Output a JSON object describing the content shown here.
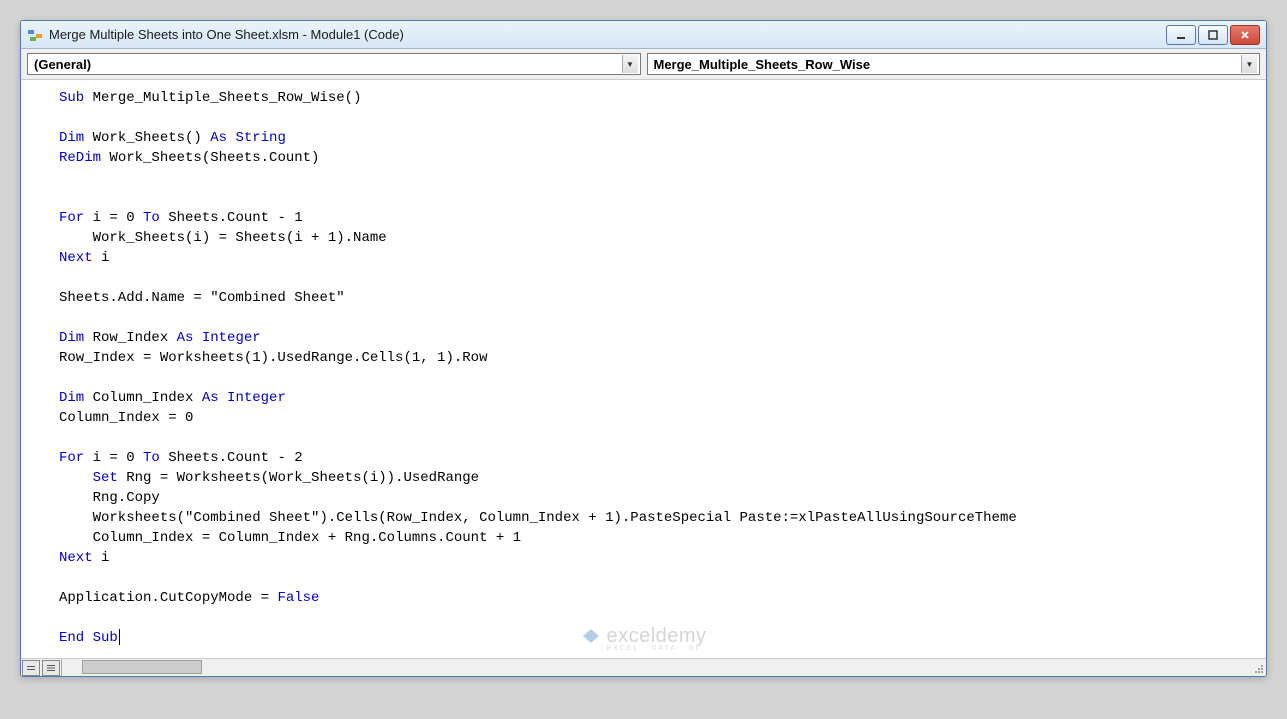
{
  "window": {
    "title": "Merge Multiple Sheets into One Sheet.xlsm - Module1 (Code)"
  },
  "dropdowns": {
    "left": "(General)",
    "right": "Merge_Multiple_Sheets_Row_Wise"
  },
  "code": {
    "tokens": [
      {
        "t": "kw",
        "v": "Sub"
      },
      {
        "t": "txt",
        "v": " Merge_Multiple_Sheets_Row_Wise()\n\n"
      },
      {
        "t": "kw",
        "v": "Dim"
      },
      {
        "t": "txt",
        "v": " Work_Sheets() "
      },
      {
        "t": "kw",
        "v": "As String"
      },
      {
        "t": "txt",
        "v": "\n"
      },
      {
        "t": "kw",
        "v": "ReDim"
      },
      {
        "t": "txt",
        "v": " Work_Sheets(Sheets.Count)\n\n\n"
      },
      {
        "t": "kw",
        "v": "For"
      },
      {
        "t": "txt",
        "v": " i = 0 "
      },
      {
        "t": "kw",
        "v": "To"
      },
      {
        "t": "txt",
        "v": " Sheets.Count - 1\n    Work_Sheets(i) = Sheets(i + 1).Name\n"
      },
      {
        "t": "kw",
        "v": "Next"
      },
      {
        "t": "txt",
        "v": " i\n\nSheets.Add.Name = \"Combined Sheet\"\n\n"
      },
      {
        "t": "kw",
        "v": "Dim"
      },
      {
        "t": "txt",
        "v": " Row_Index "
      },
      {
        "t": "kw",
        "v": "As Integer"
      },
      {
        "t": "txt",
        "v": "\nRow_Index = Worksheets(1).UsedRange.Cells(1, 1).Row\n\n"
      },
      {
        "t": "kw",
        "v": "Dim"
      },
      {
        "t": "txt",
        "v": " Column_Index "
      },
      {
        "t": "kw",
        "v": "As Integer"
      },
      {
        "t": "txt",
        "v": "\nColumn_Index = 0\n\n"
      },
      {
        "t": "kw",
        "v": "For"
      },
      {
        "t": "txt",
        "v": " i = 0 "
      },
      {
        "t": "kw",
        "v": "To"
      },
      {
        "t": "txt",
        "v": " Sheets.Count - 2\n    "
      },
      {
        "t": "kw",
        "v": "Set"
      },
      {
        "t": "txt",
        "v": " Rng = Worksheets(Work_Sheets(i)).UsedRange\n    Rng.Copy\n    Worksheets(\"Combined Sheet\").Cells(Row_Index, Column_Index + 1).PasteSpecial Paste:=xlPasteAllUsingSourceTheme\n    Column_Index = Column_Index + Rng.Columns.Count + 1\n"
      },
      {
        "t": "kw",
        "v": "Next"
      },
      {
        "t": "txt",
        "v": " i\n\nApplication.CutCopyMode = "
      },
      {
        "t": "kw",
        "v": "False"
      },
      {
        "t": "txt",
        "v": "\n\n"
      },
      {
        "t": "kw",
        "v": "End Sub"
      }
    ]
  },
  "watermark": {
    "name": "exceldemy",
    "sub": "EXCEL · DATA · BI"
  }
}
